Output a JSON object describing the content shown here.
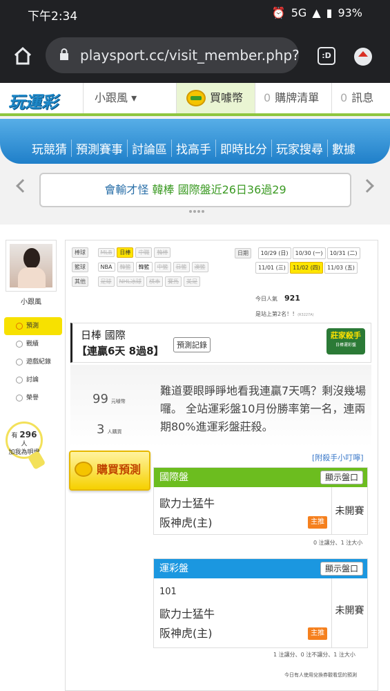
{
  "status_bar": {
    "time": "下午2:34",
    "battery": "93%",
    "network": "5G"
  },
  "browser": {
    "url": "playsport.cc/visit_member.php?",
    "tab_label": ":D"
  },
  "topnav": {
    "logo": "玩運彩",
    "user": "小跟風 ▾",
    "buy_label": "買噱幣",
    "shopping_count": "0",
    "shopping_label": "購牌清單",
    "msg_count": "0",
    "msg_label": "訊息"
  },
  "mainnav": [
    "玩競猜",
    "預測賽事",
    "討論區",
    "找高手",
    "即時比分",
    "玩家搜尋",
    "數據"
  ],
  "marquee": {
    "part1": "會輸才怪",
    "part2": "韓棒",
    "part3": "國際盤近26日36過29"
  },
  "profile": {
    "name": "小跟風"
  },
  "sidebar": [
    {
      "label": "預測",
      "icon": "target-icon"
    },
    {
      "label": "戰績",
      "icon": "chat-icon"
    },
    {
      "label": "遊戲紀錄",
      "icon": "record-icon"
    },
    {
      "label": "討論",
      "icon": "search-icon"
    },
    {
      "label": "榮譽",
      "icon": "medal-icon"
    }
  ],
  "bulb": {
    "prefix": "有",
    "count": "296",
    "unit": "人",
    "text": "加我為明燈"
  },
  "filters": {
    "baseball_label": "棒球",
    "baseball": [
      "MLB",
      "日棒",
      "中職",
      "韓棒"
    ],
    "basketball_label": "籃球",
    "basketball": [
      "NBA",
      "韓籃",
      "韓籃",
      "中籃",
      "日籃",
      "澳籃"
    ],
    "other_label": "其他",
    "other": [
      "足球",
      "NHL冰球",
      "棋本",
      "賽馬",
      "美足"
    ]
  },
  "dates": {
    "label": "日期",
    "row1": [
      "10/29 (日)",
      "10/30 (一)",
      "10/31 (二)"
    ],
    "row2": [
      "11/01 (三)",
      "11/02 (四)",
      "11/03 (五)"
    ]
  },
  "popularity": {
    "label": "今日人氣",
    "value": "921",
    "rank": "是站上第2名！！",
    "rank_small": "(R3227A)"
  },
  "header": {
    "title": "日棒 國際",
    "streak": "【連贏6天 8過8】",
    "record_btn": "預測記錄"
  },
  "badge": {
    "title": "莊家殺手",
    "sub": "日棒運彩盤"
  },
  "stats": {
    "price": "99",
    "price_unit": "元噱幣",
    "buyers": "3",
    "buyers_unit": "人購買"
  },
  "buy_button": "購買預測",
  "message": "難道要眼睜睜地看我連贏7天嗎？剩沒幾場囉。 全站運彩盤10月份勝率第一名，連兩期80%進運彩盤莊殺。",
  "tips_link": "[附殺手小叮嚀]",
  "intl_panel": {
    "title": "國際盤",
    "btn": "顯示盤口",
    "team1": "歐力士猛牛",
    "team2": "阪神虎(主)",
    "pick": "主推",
    "status": "未開賽",
    "note": "0 注讓分、1 注大小"
  },
  "sport_panel": {
    "title": "運彩盤",
    "btn": "顯示盤口",
    "code": "101",
    "team1": "歐力士猛牛",
    "team2": "阪神虎(主)",
    "pick": "主推",
    "status": "未開賽",
    "note": "1 注讓分、0 注不讓分、1 注大小"
  },
  "footer_note": "今日有人使用兌換券觀看您的預測",
  "colors": {
    "intl": "#6cbd1f",
    "sport": "#1b97e0",
    "accent": "#f7e100"
  }
}
